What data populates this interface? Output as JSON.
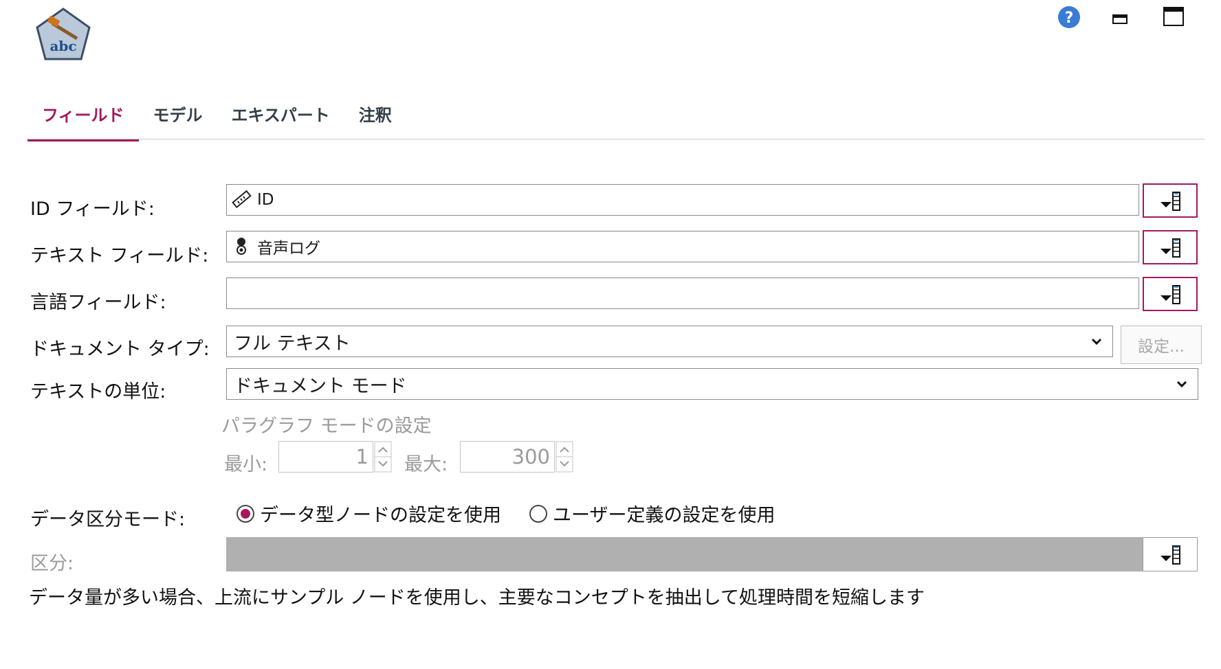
{
  "window": {
    "app_icon_text": "abc"
  },
  "tabs": [
    {
      "label": "フィールド",
      "active": true
    },
    {
      "label": "モデル",
      "active": false
    },
    {
      "label": "エキスパート",
      "active": false
    },
    {
      "label": "注釈",
      "active": false
    }
  ],
  "fields": {
    "id_field": {
      "label": "ID フィールド:",
      "value": "ID",
      "icon": "ruler-icon"
    },
    "text_field": {
      "label": "テキスト フィールド:",
      "value": "音声ログ",
      "icon": "nominal-field-icon"
    },
    "language_field": {
      "label": "言語フィールド:",
      "value": ""
    }
  },
  "document_type": {
    "label": "ドキュメント タイプ:",
    "value": "フル テキスト",
    "settings_label": "設定..."
  },
  "text_unit": {
    "label": "テキストの単位:",
    "value": "ドキュメント モード"
  },
  "paragraph": {
    "title": "パラグラフ モードの設定",
    "min_label": "最小:",
    "min_value": "1",
    "max_label": "最大:",
    "max_value": "300"
  },
  "partition_mode": {
    "label": "データ区分モード:",
    "options": [
      {
        "label": "データ型ノードの設定を使用",
        "selected": true
      },
      {
        "label": "ユーザー定義の設定を使用",
        "selected": false
      }
    ]
  },
  "partition": {
    "label": "区分:"
  },
  "note": "データ量が多い場合、上流にサンプル ノードを使用し、主要なコンセプトを抽出して処理時間を短縮します",
  "colors": {
    "accent": "#a3185d",
    "help": "#3a7bd5",
    "disabled_bar": "#b0b0b0"
  }
}
